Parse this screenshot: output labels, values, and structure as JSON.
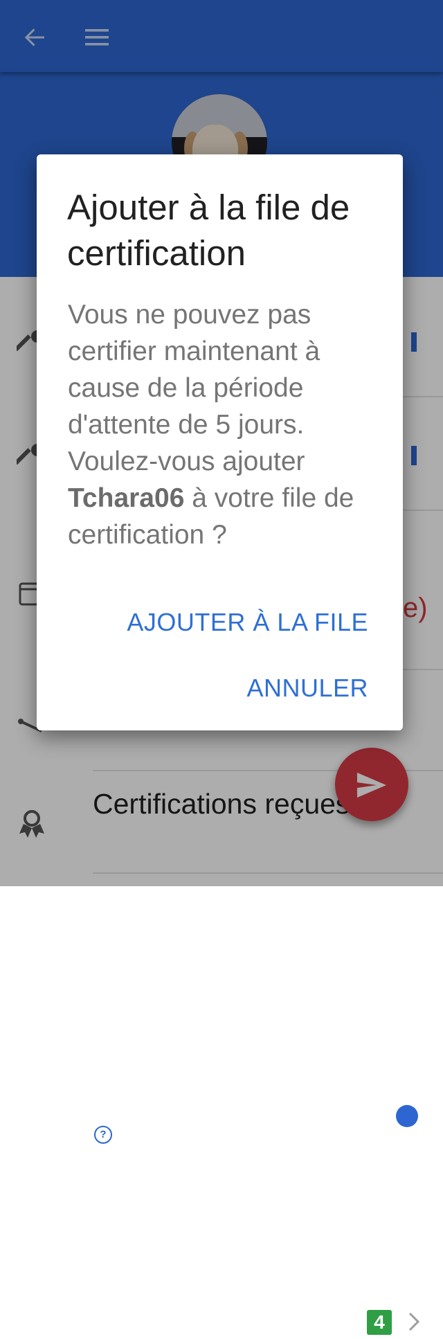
{
  "appbar": {
    "back_icon": "arrow-back-icon",
    "menu_icon": "hamburger-menu-icon",
    "color": "#2d66d0"
  },
  "list": {
    "rows": [
      {
        "icon": "key-icon"
      },
      {
        "icon": "key-icon"
      },
      {
        "icon": "calendar-icon",
        "right_text": "e)"
      },
      {
        "icon": "chain-icon",
        "help": "?"
      },
      {
        "icon": "certification-badge-icon",
        "label": "Certifications reçues",
        "count": "4"
      }
    ]
  },
  "fab": {
    "icon": "send-icon",
    "color": "#d63a44"
  },
  "dialog": {
    "title": "Ajouter à la file de certification",
    "message_before": "Vous ne pouvez pas certifier maintenant à cause de la période d'attente de 5 jours. Voulez-vous ajouter ",
    "message_user": "Tchara06",
    "message_after": " à votre file de certification ?",
    "add_button": "AJOUTER À LA FILE",
    "cancel_button": "ANNULER",
    "accent": "#2f6fd4"
  }
}
